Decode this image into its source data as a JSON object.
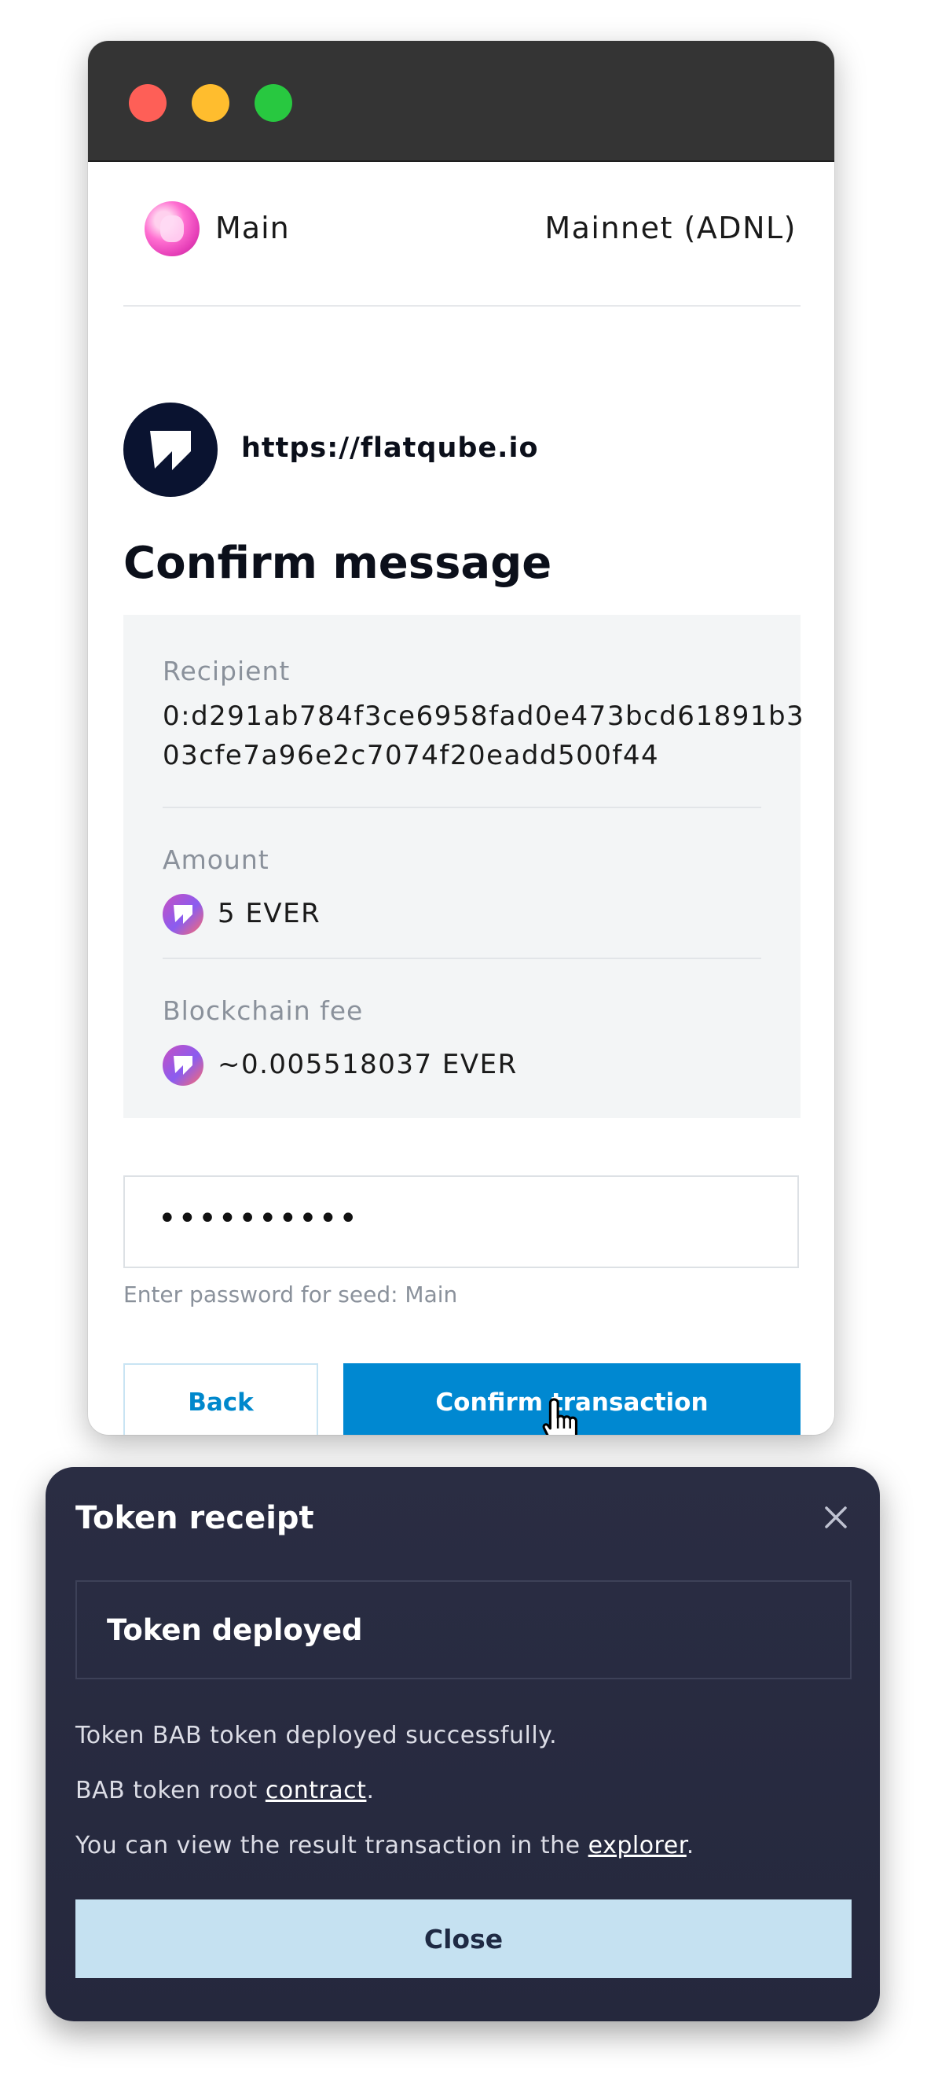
{
  "window": {
    "buttons": [
      "close",
      "minimize",
      "maximize"
    ]
  },
  "account": {
    "name": "Main",
    "network": "Mainnet (ADNL)"
  },
  "site": {
    "url": "https://flatqube.io"
  },
  "page": {
    "title": "Confirm message"
  },
  "details": {
    "recipient_label": "Recipient",
    "recipient_line1": "0:d291ab784f3ce6958fad0e473bcd61891b3",
    "recipient_line2": "03cfe7a96e2c7074f20eadd500f44",
    "amount_label": "Amount",
    "amount_value": "5 EVER",
    "fee_label": "Blockchain fee",
    "fee_value": "~0.005518037 EVER"
  },
  "password": {
    "masked_value": "••••••••••",
    "hint": "Enter password for seed: Main"
  },
  "actions": {
    "back_label": "Back",
    "confirm_label": "Confirm transaction"
  },
  "receipt": {
    "title": "Token receipt",
    "status": "Token deployed",
    "line1": "Token BAB token deployed successfully.",
    "line2_prefix": "BAB token root ",
    "line2_link": "contract",
    "line2_suffix": ".",
    "line3_prefix": "You can view the result transaction in the ",
    "line3_link": "explorer",
    "line3_suffix": ".",
    "close_label": "Close"
  },
  "colors": {
    "titlebar": "#343434",
    "traffic_red": "#fe5f57",
    "traffic_yellow": "#ffbd2e",
    "traffic_green": "#28c840",
    "primary": "#0088d1",
    "receipt_bg": "#2a2d43",
    "receipt_button": "#c5e1f1"
  },
  "icons": [
    "account-avatar-icon",
    "flatqube-logo-icon",
    "ever-token-icon",
    "close-icon",
    "hand-cursor-icon"
  ]
}
